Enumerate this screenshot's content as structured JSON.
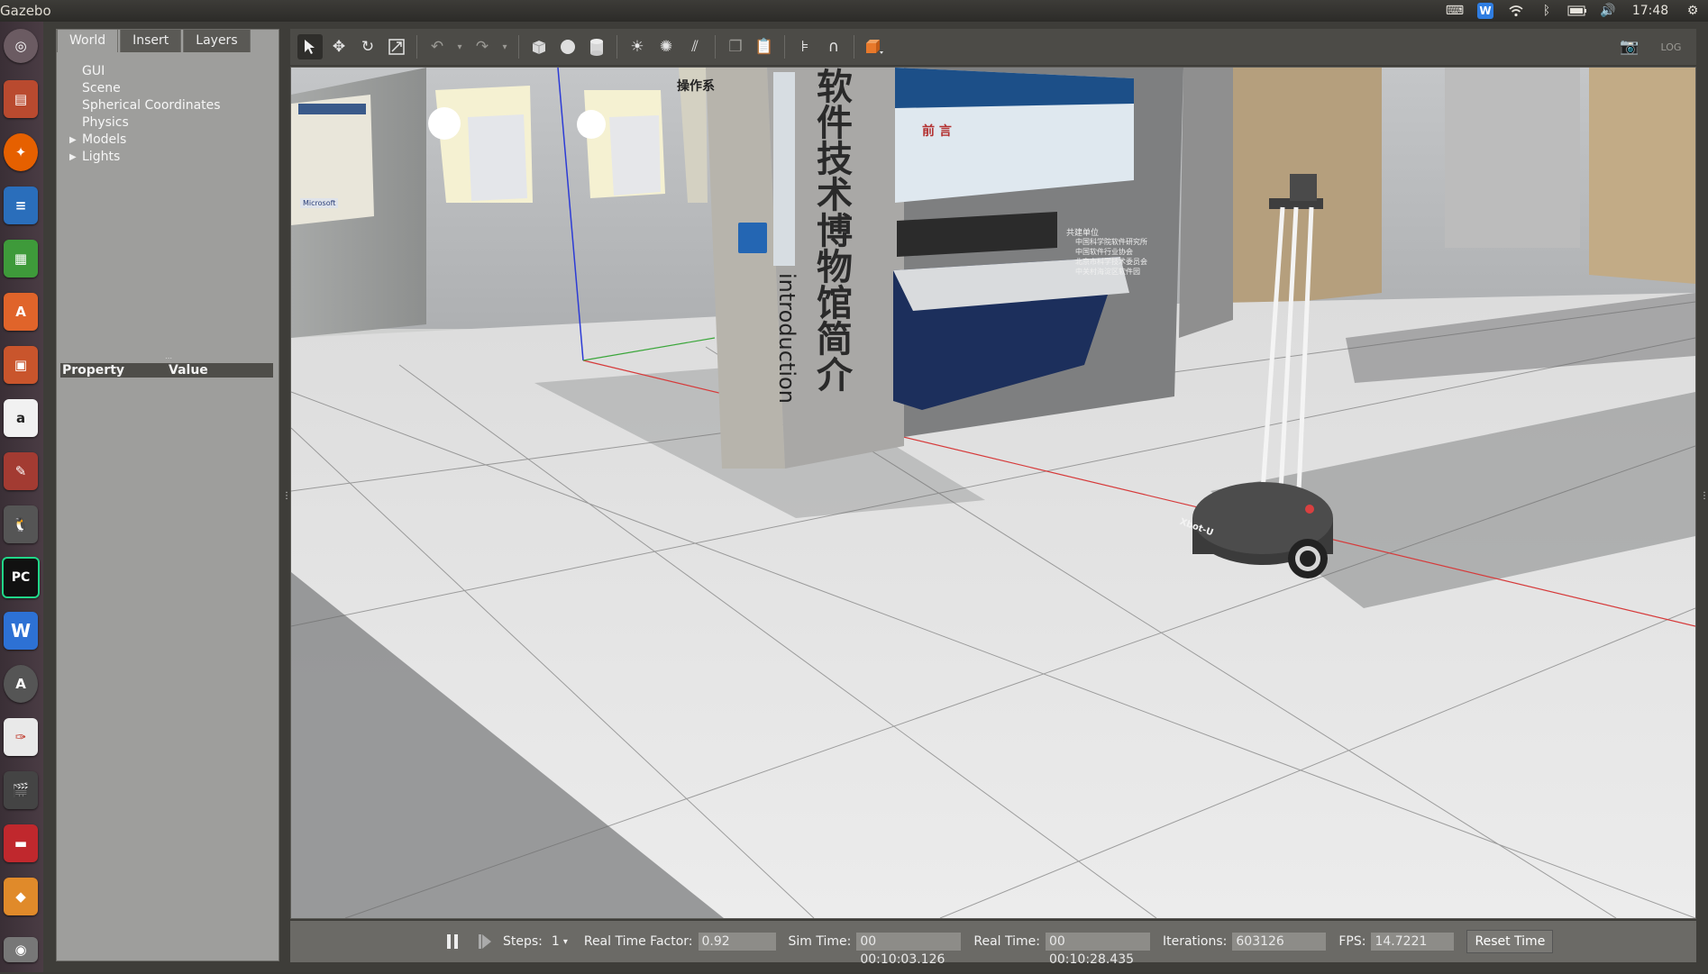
{
  "topbar": {
    "app_title": "Gazebo",
    "clock": "17:48",
    "tray_icons": [
      "keyboard-icon",
      "wps-icon",
      "wifi-icon",
      "bluetooth-icon",
      "battery-icon",
      "volume-icon",
      "settings-gear-icon"
    ]
  },
  "launcher": {
    "items": [
      "ubuntu-dash-icon",
      "files-icon",
      "firefox-icon",
      "writer-icon",
      "calc-icon",
      "software-center-icon",
      "impress-icon",
      "amazon-icon",
      "system-settings-icon",
      "tux-icon",
      "pycharm-icon",
      "wps-writer-icon",
      "software-updater-icon",
      "document-viewer-icon",
      "video-editor-icon",
      "red-app-icon",
      "blender-like-icon",
      "camera-icon"
    ],
    "labels": [
      "",
      "",
      "",
      "",
      "",
      "A",
      "",
      "a",
      "",
      "",
      "PC",
      "W",
      "A",
      "",
      "",
      "",
      "",
      ""
    ]
  },
  "left_panel": {
    "tabs": [
      "World",
      "Insert",
      "Layers"
    ],
    "active_tab": "World",
    "tree": [
      {
        "label": "GUI",
        "expandable": false
      },
      {
        "label": "Scene",
        "expandable": false
      },
      {
        "label": "Spherical Coordinates",
        "expandable": false
      },
      {
        "label": "Physics",
        "expandable": false
      },
      {
        "label": "Models",
        "expandable": true
      },
      {
        "label": "Lights",
        "expandable": true
      }
    ],
    "property_header": {
      "property": "Property",
      "value": "Value"
    }
  },
  "toolbar": {
    "tools": [
      "select-arrow-icon",
      "translate-icon",
      "rotate-icon",
      "scale-icon",
      "undo-icon",
      "redo-icon",
      "box-icon",
      "sphere-icon",
      "cylinder-icon",
      "point-light-icon",
      "spot-light-icon",
      "directional-light-icon",
      "copy-icon",
      "paste-icon",
      "align-icon",
      "snap-icon",
      "view-angle-icon"
    ],
    "right_tools": [
      "screenshot-icon",
      "log-icon"
    ]
  },
  "scene": {
    "museum_title": "软件技术博物馆简介",
    "museum_subtitle": "introduction",
    "panel_heading": "前 言",
    "partner_label": "共建单位",
    "partners": [
      "中国科学院软件研究所",
      "中国软件行业协会",
      "北京市科学技术委员会",
      "中关村海淀区软件园"
    ],
    "ops_sign": "操作系",
    "poster_logo": "Microsoft",
    "robot_label": "Xbot-U"
  },
  "bottom_bar": {
    "steps_label": "Steps:",
    "steps_value": "1",
    "rtf_label": "Real Time Factor:",
    "rtf_value": "0.92",
    "sim_time_label": "Sim Time:",
    "sim_time_value": "00 00:10:03.126",
    "real_time_label": "Real Time:",
    "real_time_value": "00 00:10:28.435",
    "iterations_label": "Iterations:",
    "iterations_value": "603126",
    "fps_label": "FPS:",
    "fps_value": "14.7221",
    "reset_label": "Reset Time"
  }
}
